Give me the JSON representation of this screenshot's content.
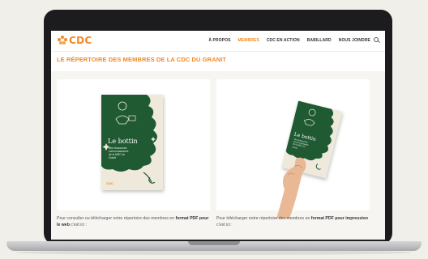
{
  "header": {
    "logo_text": "CDC",
    "nav": [
      "À PROPOS",
      "MEMBRES",
      "CDC EN ACTION",
      "BABILLARD",
      "NOUS JOINDRE"
    ],
    "active_nav": "MEMBRES"
  },
  "page": {
    "title": "LE RÉPERTOIRE DES MEMBRES DE LA CDC DU GRANIT"
  },
  "brochure": {
    "title_line1": "Le bottin",
    "subtitle_lines": [
      "des ressources",
      "communautaires",
      "de la MRC du",
      "Granit"
    ],
    "footer_logo": "CDC"
  },
  "captions": {
    "left": {
      "before": "Pour consulter ou télécharger notre répertoire des membres en",
      "bold": "format PDF pour le web",
      "after": " c'est ici :"
    },
    "right": {
      "before": "Pour télécharger notre répertoire des membres en",
      "bold1": "format PDF pour",
      "bold2": "impression",
      "after": " c'est ici :"
    }
  },
  "colors": {
    "accent": "#f08a24",
    "brochure_green": "#1f5a33",
    "brochure_cream": "#efe9dc"
  }
}
